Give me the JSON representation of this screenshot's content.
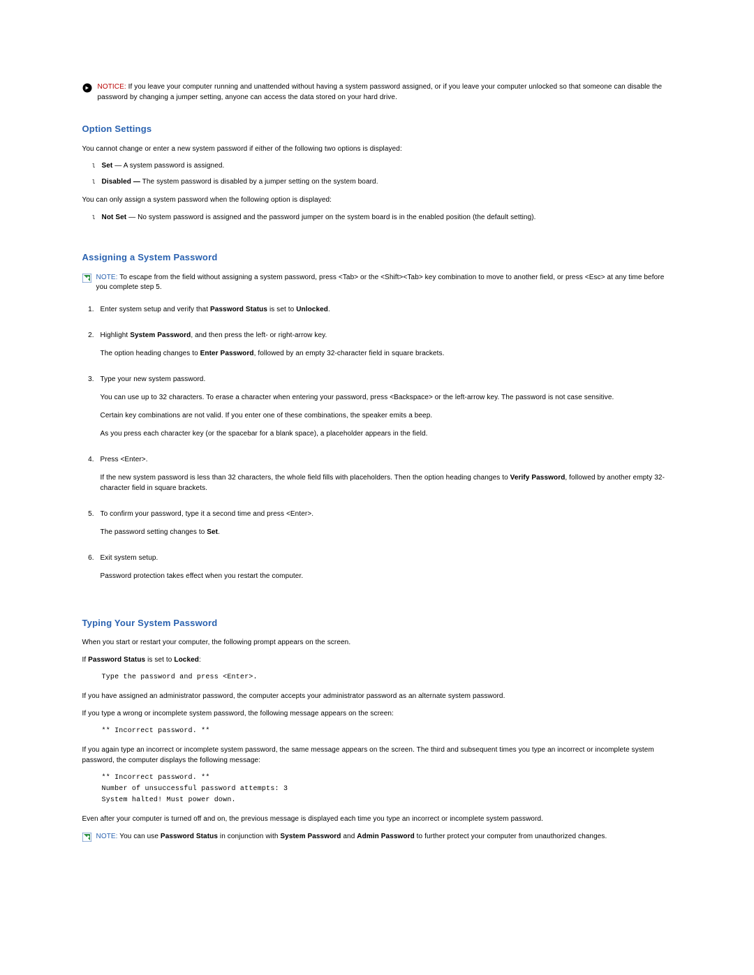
{
  "notice": {
    "label": "NOTICE:",
    "text": "If you leave your computer running and unattended without having a system password assigned, or if you leave your computer unlocked so that someone can disable the password by changing a jumper setting, anyone can access the data stored on your hard drive."
  },
  "section1": {
    "heading": "Option Settings",
    "intro": "You cannot change or enter a new system password if either of the following two options is displayed:",
    "bullets_a": [
      {
        "bold": "Set",
        "sep": " — ",
        "rest": "A system password is assigned."
      },
      {
        "bold": "Disabled —",
        "sep": " ",
        "rest": "The system password is disabled by a jumper setting on the system board."
      }
    ],
    "between": "You can only assign a system password when the following option is displayed:",
    "bullets_b": [
      {
        "bold": "Not Set",
        "sep": " — ",
        "rest": "No system password is assigned and the password jumper on the system board is in the enabled position (the default setting)."
      }
    ]
  },
  "section2": {
    "heading": "Assigning a System Password",
    "note": {
      "label": "NOTE:",
      "text": "To escape from the field without assigning a system password, press <Tab> or the <Shift><Tab> key combination to move to another field, or press <Esc> at any time before you complete step 5."
    },
    "steps": {
      "s1_a": "Enter system setup and verify that ",
      "s1_b": "Password Status",
      "s1_c": " is set to ",
      "s1_d": "Unlocked",
      "s1_e": ".",
      "s2_a": "Highlight ",
      "s2_b": "System Password",
      "s2_c": ", and then press the left- or right-arrow key.",
      "s2_sub1_a": "The option heading changes to ",
      "s2_sub1_b": "Enter Password",
      "s2_sub1_c": ", followed by an empty 32-character field in square brackets.",
      "s3_a": "Type your new system password.",
      "s3_sub1": "You can use up to 32 characters. To erase a character when entering your password, press <Backspace> or the left-arrow key. The password is not case sensitive.",
      "s3_sub2": "Certain key combinations are not valid. If you enter one of these combinations, the speaker emits a beep.",
      "s3_sub3": "As you press each character key (or the spacebar for a blank space), a placeholder appears in the field.",
      "s4_a": "Press <Enter>.",
      "s4_sub1_a": "If the new system password is less than 32 characters, the whole field fills with placeholders. Then the option heading changes to ",
      "s4_sub1_b": "Verify Password",
      "s4_sub1_c": ", followed by another empty 32-character field in square brackets.",
      "s5_a": "To confirm your password, type it a second time and press <Enter>.",
      "s5_sub1_a": "The password setting changes to ",
      "s5_sub1_b": "Set",
      "s5_sub1_c": ".",
      "s6_a": "Exit system setup.",
      "s6_sub1": "Password protection takes effect when you restart the computer."
    }
  },
  "section3": {
    "heading": "Typing Your System Password",
    "p1": "When you start or restart your computer, the following prompt appears on the screen.",
    "p2_a": "If ",
    "p2_b": "Password Status",
    "p2_c": " is set to ",
    "p2_d": "Locked",
    "p2_e": ":",
    "code1": "Type the password and press <Enter>.",
    "p3": "If you have assigned an administrator password, the computer accepts your administrator password as an alternate system password.",
    "p4": "If you type a wrong or incomplete system password, the following message appears on the screen:",
    "code2": "** Incorrect password. **",
    "p5": "If you again type an incorrect or incomplete system password, the same message appears on the screen. The third and subsequent times you type an incorrect or incomplete system password, the computer displays the following message:",
    "code3": "** Incorrect password. **\nNumber of unsuccessful password attempts: 3\nSystem halted! Must power down.",
    "p6": "Even after your computer is turned off and on, the previous message is displayed each time you type an incorrect or incomplete system password.",
    "note2": {
      "label": "NOTE:",
      "text_a": "You can use ",
      "text_b": "Password Status",
      "text_c": " in conjunction with ",
      "text_d": "System Password",
      "text_e": " and ",
      "text_f": "Admin Password",
      "text_g": " to further protect your computer from unauthorized changes."
    }
  }
}
